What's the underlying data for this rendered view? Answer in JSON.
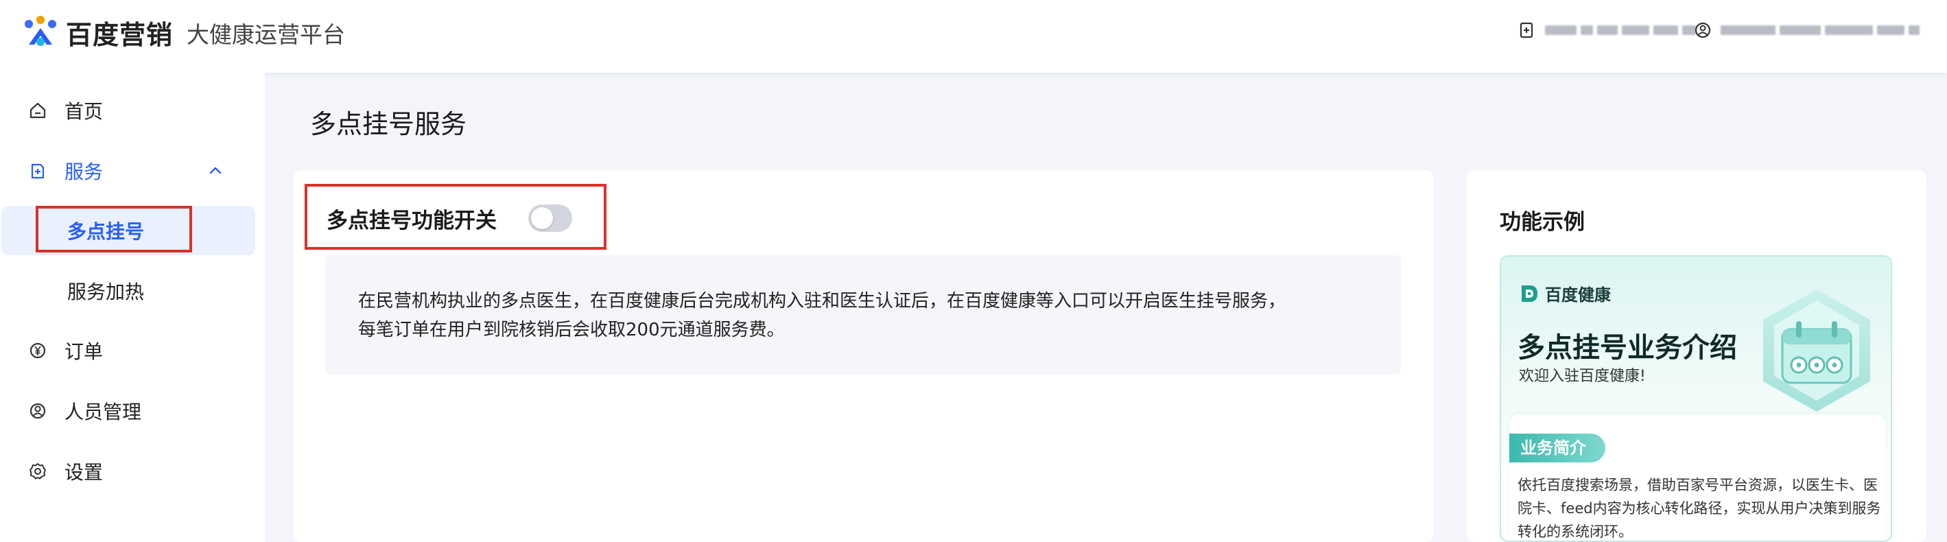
{
  "header": {
    "brand": "百度营销",
    "platform": "大健康运营平台",
    "user_account_masked": "",
    "user_email_masked": ""
  },
  "sidebar": {
    "items": [
      {
        "label": "首页",
        "icon": "home-icon"
      },
      {
        "label": "服务",
        "icon": "service-icon"
      },
      {
        "label": "订单",
        "icon": "yuan-icon"
      },
      {
        "label": "人员管理",
        "icon": "person-icon"
      },
      {
        "label": "设置",
        "icon": "gear-icon"
      }
    ],
    "service_subitems": [
      {
        "label": "多点挂号"
      },
      {
        "label": "服务加热"
      }
    ]
  },
  "main": {
    "title": "多点挂号服务",
    "switch_label": "多点挂号功能开关",
    "switch_on": false,
    "description_line1": "在民营机构执业的多点医生，在百度健康后台完成机构入驻和医生认证后，在百度健康等入口可以开启医生挂号服务，",
    "description_line2": "每笔订单在用户到院核销后会收取200元通道服务费。"
  },
  "example": {
    "title": "功能示例",
    "brand": "百度健康",
    "headline": "多点挂号业务介绍",
    "welcome": "欢迎入驻百度健康!",
    "tag": "业务简介",
    "desc_line1": "依托百度搜索场景，借助百家号平台资源，以医生卡、医",
    "desc_line2": "院卡、feed内容为核心转化路径，实现从用户决策到服务",
    "desc_line3": "转化的系统闭环。"
  },
  "colors": {
    "accent": "#2a5ef6",
    "highlight_border": "#d8322a",
    "teal": "#3bb9ad"
  }
}
